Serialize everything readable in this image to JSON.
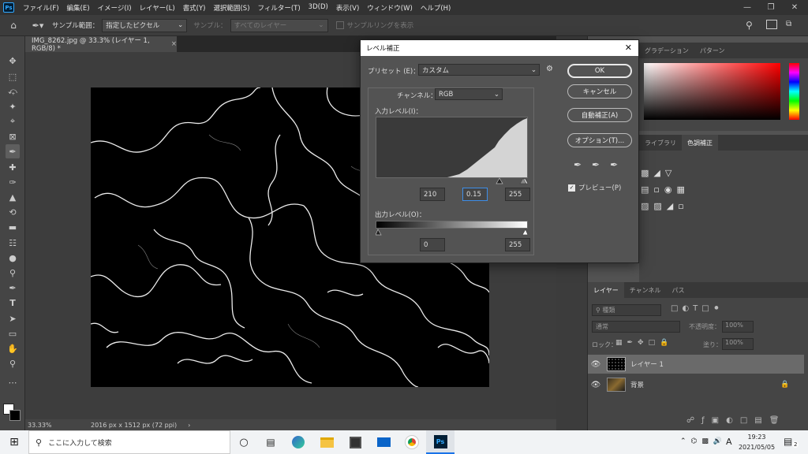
{
  "app": {
    "logo": "Ps"
  },
  "menu": [
    "ファイル(F)",
    "編集(E)",
    "イメージ(I)",
    "レイヤー(L)",
    "書式(Y)",
    "選択範囲(S)",
    "フィルター(T)",
    "3D(D)",
    "表示(V)",
    "ウィンドウ(W)",
    "ヘルプ(H)"
  ],
  "options": {
    "sample_range_label": "サンプル範囲：",
    "sample_range_value": "指定したピクセル",
    "sample_label": "サンプル：",
    "sample_value": "すべてのレイヤー",
    "sample_ring": "サンプルリングを表示"
  },
  "document": {
    "tab_title": "IMG_8262.jpg @ 33.3% (レイヤー 1, RGB/8) *",
    "zoom": "33.33%",
    "dimensions": "2016 px x 1512 px (72 ppi)"
  },
  "panels": {
    "color_tabs": [
      "グラデーション",
      "パターン"
    ],
    "adjust_tabs": [
      "ライブラリ",
      "色調補正"
    ],
    "layers_tabs": [
      "レイヤー",
      "チャンネル",
      "パス"
    ],
    "kind_placeholder": "種類",
    "blend_mode": "通常",
    "opacity_label": "不透明度：",
    "opacity_value": "100%",
    "lock_label": "ロック：",
    "fill_label": "塗り：",
    "fill_value": "100%",
    "layers": [
      {
        "name": "レイヤー 1",
        "selected": true
      },
      {
        "name": "背景",
        "locked": true
      }
    ]
  },
  "dialog": {
    "title": "レベル補正",
    "preset_label": "プリセット (E)：",
    "preset_value": "カスタム",
    "channel_label": "チャンネル：",
    "channel_value": "RGB",
    "input_label": "入力レベル(I)：",
    "input_black": "210",
    "input_gamma": "0.15",
    "input_white": "255",
    "output_label": "出力レベル(O)：",
    "output_black": "0",
    "output_white": "255",
    "ok": "OK",
    "cancel": "キャンセル",
    "auto": "自動補正(A)",
    "options": "オプション(T)...",
    "preview": "プレビュー(P)",
    "preview_checked": true
  },
  "taskbar": {
    "search_placeholder": "ここに入力して検索",
    "time": "19:23",
    "date": "2021/05/05",
    "notif_count": "2",
    "ime": "A"
  },
  "colors": {
    "accent": "#31a8ff",
    "selection": "#1473e6"
  }
}
